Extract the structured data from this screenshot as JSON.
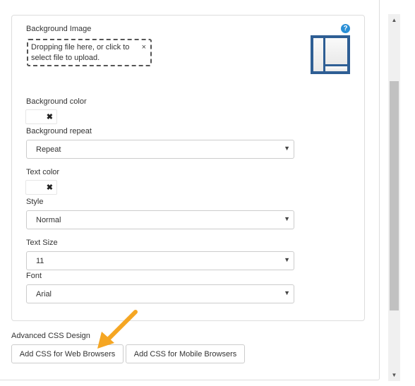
{
  "background_image": {
    "label": "Background Image",
    "dropzone_text": "Dropping file here, or click to select file to upload.",
    "dropzone_close": "×",
    "help_icon": "?",
    "preview_icon": "layout-preview-icon"
  },
  "background_color": {
    "label": "Background color",
    "clear_glyph": "✖"
  },
  "background_repeat": {
    "label": "Background repeat",
    "value": "Repeat",
    "caret": "▼"
  },
  "text_color": {
    "label": "Text color",
    "clear_glyph": "✖"
  },
  "style": {
    "label": "Style",
    "value": "Normal",
    "caret": "▼"
  },
  "text_size": {
    "label": "Text Size",
    "value": "11",
    "caret": "▼"
  },
  "font": {
    "label": "Font",
    "value": "Arial",
    "caret": "▼"
  },
  "advanced": {
    "label": "Advanced CSS Design",
    "web_button": "Add CSS for Web Browsers",
    "mobile_button": "Add CSS for Mobile Browsers"
  },
  "annotation": {
    "arrow_color": "#f5a623"
  },
  "scrollbar": {
    "up": "▲",
    "down": "▼"
  }
}
